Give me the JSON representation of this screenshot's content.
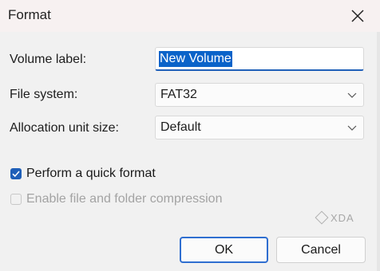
{
  "window": {
    "title": "Format"
  },
  "form": {
    "volume_label_caption": "Volume label:",
    "volume_label_value": "New Volume",
    "file_system_caption": "File system:",
    "file_system_value": "FAT32",
    "allocation_caption": "Allocation unit size:",
    "allocation_value": "Default"
  },
  "options": {
    "quick_format_label": "Perform a quick format",
    "quick_format_checked": true,
    "compression_label": "Enable file and folder compression",
    "compression_checked": false,
    "compression_disabled": true
  },
  "buttons": {
    "ok_label": "OK",
    "cancel_label": "Cancel"
  },
  "watermark": {
    "text": "XDA"
  },
  "icons": {
    "close": "close-icon",
    "chevron": "chevron-down-icon",
    "check": "check-icon"
  },
  "colors": {
    "accent": "#1f5fb8",
    "selection": "#0a63c9",
    "dialog_bg": "#f1f1f1"
  }
}
